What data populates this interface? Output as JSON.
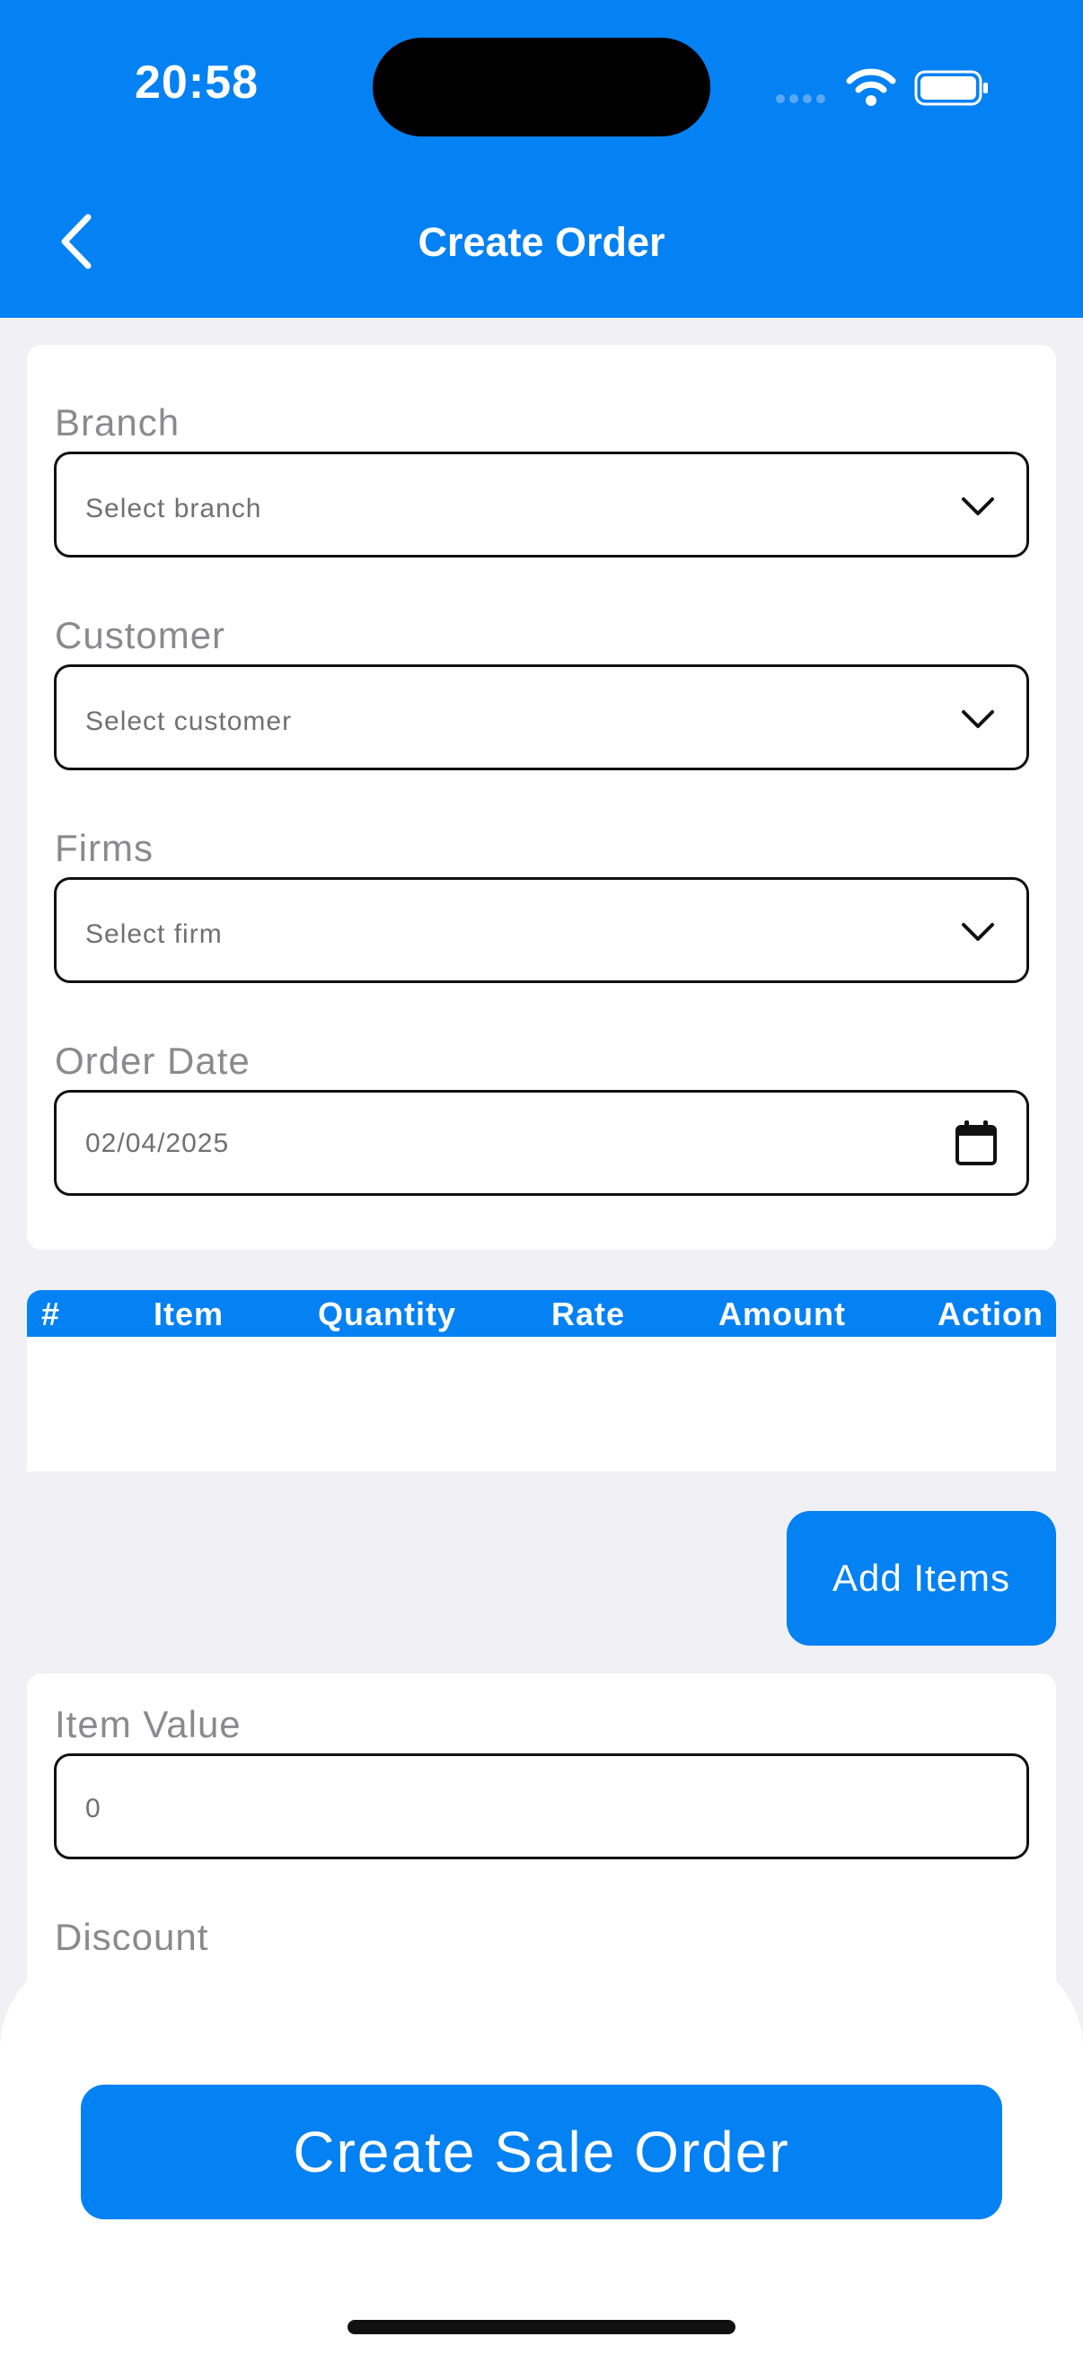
{
  "status_bar": {
    "time": "20:58"
  },
  "header": {
    "title": "Create Order"
  },
  "form": {
    "branch": {
      "label": "Branch",
      "placeholder": "Select branch"
    },
    "customer": {
      "label": "Customer",
      "placeholder": "Select customer"
    },
    "firm": {
      "label": "Firms",
      "placeholder": "Select firm"
    },
    "order_date": {
      "label": "Order Date",
      "value": "02/04/2025"
    }
  },
  "items_table": {
    "columns": [
      "#",
      "Item",
      "Quantity",
      "Rate",
      "Amount",
      "Action"
    ],
    "rows": []
  },
  "add_items_label": "Add Items",
  "summary": {
    "item_value": {
      "label": "Item Value",
      "value": "0"
    },
    "discount": {
      "label": "Discount"
    }
  },
  "create_button_label": "Create Sale Order",
  "colors": {
    "primary": "#0481F2",
    "background": "#F0F0F5",
    "label": "#8A8A8E"
  }
}
